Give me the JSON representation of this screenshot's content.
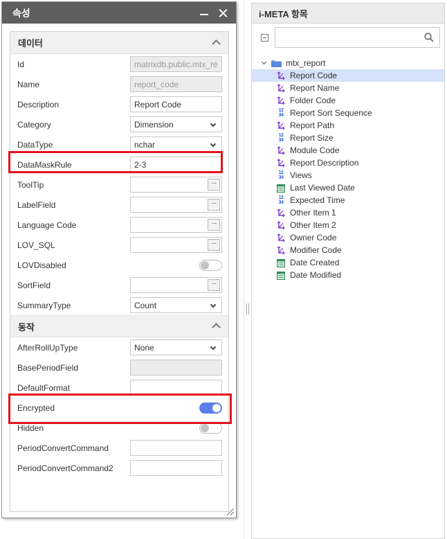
{
  "properties": {
    "title": "속성",
    "sections": {
      "data_title": "데이터",
      "action_title": "동작"
    },
    "rows": {
      "id": {
        "label": "Id",
        "value": "matrixdb.public.mtx_re"
      },
      "name": {
        "label": "Name",
        "value": "report_code"
      },
      "description": {
        "label": "Description",
        "value": "Report Code"
      },
      "category": {
        "label": "Category",
        "value": "Dimension"
      },
      "datatype": {
        "label": "DataType",
        "value": "nchar"
      },
      "datamaskrule": {
        "label": "DataMaskRule",
        "value": "2-3"
      },
      "tooltip": {
        "label": "ToolTip",
        "value": ""
      },
      "labelfield": {
        "label": "LabelField",
        "value": ""
      },
      "languagecode": {
        "label": "Language Code",
        "value": ""
      },
      "lovsql": {
        "label": "LOV_SQL",
        "value": ""
      },
      "lovdisabled": {
        "label": "LOVDisabled",
        "value": false
      },
      "sortfield": {
        "label": "SortField",
        "value": ""
      },
      "summarytype": {
        "label": "SummaryType",
        "value": "Count"
      },
      "afterrolluptype": {
        "label": "AfterRollUpType",
        "value": "None"
      },
      "baseperiodfield": {
        "label": "BasePeriodField",
        "value": ""
      },
      "defaultformat": {
        "label": "DefaultFormat",
        "value": ""
      },
      "encrypted": {
        "label": "Encrypted",
        "value": true
      },
      "hidden": {
        "label": "Hidden",
        "value": false
      },
      "periodconvertcommand": {
        "label": "PeriodConvertCommand",
        "value": ""
      },
      "periodconvertcommand2": {
        "label": "PeriodConvertCommand2",
        "value": ""
      }
    },
    "ellipsis": "···",
    "highlight_color": "#e3141f",
    "toggle_on_color": "#5b7fe8"
  },
  "meta_panel": {
    "title": "i-META 항목",
    "search_placeholder": "",
    "root": "mtx_report",
    "items": [
      {
        "label": "Report Code",
        "icon": "dimension-icon",
        "selected": true
      },
      {
        "label": "Report Name",
        "icon": "dimension-icon"
      },
      {
        "label": "Folder Code",
        "icon": "dimension-icon"
      },
      {
        "label": "Report Sort Sequence",
        "icon": "numeric-icon"
      },
      {
        "label": "Report Path",
        "icon": "dimension-icon"
      },
      {
        "label": "Report Size",
        "icon": "numeric-icon"
      },
      {
        "label": "Module Code",
        "icon": "dimension-icon"
      },
      {
        "label": "Report Description",
        "icon": "dimension-icon"
      },
      {
        "label": "Views",
        "icon": "numeric-icon"
      },
      {
        "label": "Last Viewed Date",
        "icon": "calendar-icon"
      },
      {
        "label": "Expected Time",
        "icon": "numeric-icon"
      },
      {
        "label": "Other Item 1",
        "icon": "dimension-icon"
      },
      {
        "label": "Other Item 2",
        "icon": "dimension-icon"
      },
      {
        "label": "Owner Code",
        "icon": "dimension-icon"
      },
      {
        "label": "Modifier Code",
        "icon": "dimension-icon"
      },
      {
        "label": "Date Created",
        "icon": "calendar-icon"
      },
      {
        "label": "Date Modified",
        "icon": "calendar-icon"
      }
    ],
    "numeric_glyph_top": "12",
    "numeric_glyph_bottom": "34",
    "selected_color": "#d6e2fb"
  }
}
